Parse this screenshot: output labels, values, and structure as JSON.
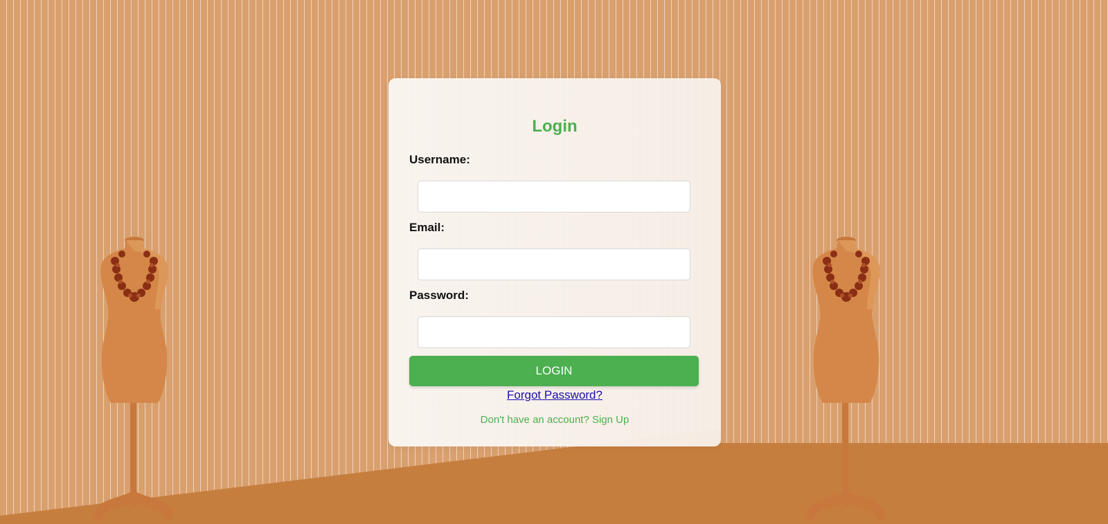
{
  "login": {
    "title": "Login",
    "username_label": "Username:",
    "username_value": "",
    "email_label": "Email:",
    "email_value": "",
    "password_label": "Password:",
    "password_value": "",
    "submit_label": "LOGIN",
    "forgot_password": "Forgot Password?",
    "signup_prompt": "Don't have an account? Sign Up"
  },
  "colors": {
    "accent_green": "#4caf50",
    "wall": "#d9a06e",
    "floor": "#c67e3f",
    "link": "#1a0dab"
  },
  "decor": {
    "icons": [
      "mannequin-icon",
      "flower-wreath-icon"
    ]
  }
}
